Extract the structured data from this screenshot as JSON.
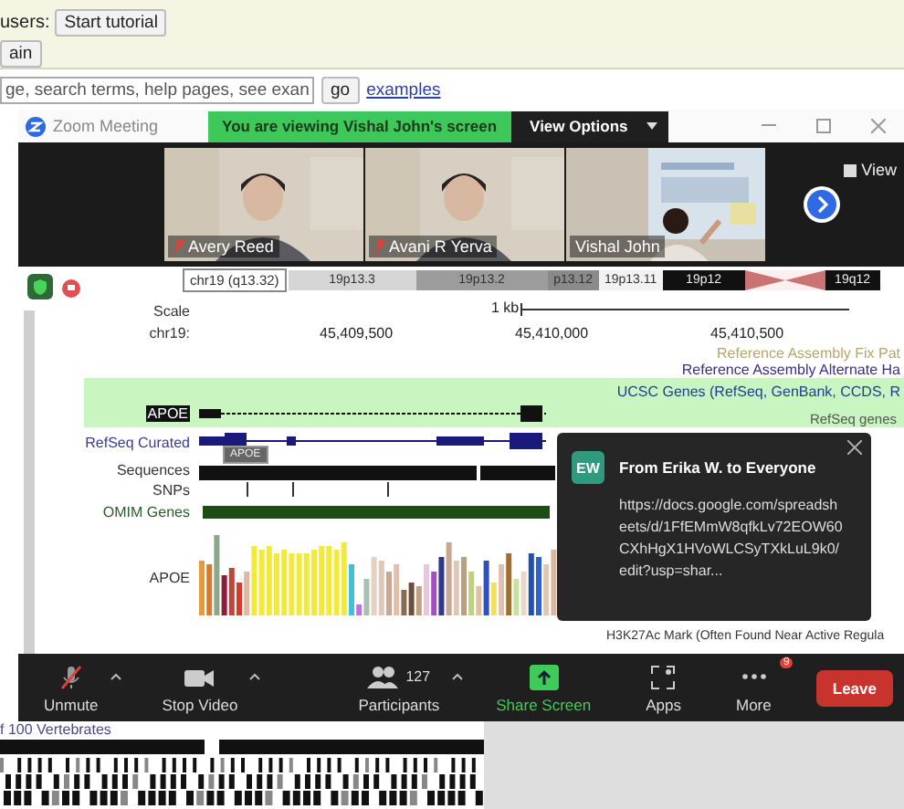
{
  "page": {
    "tutorial_label": "users:",
    "tutorial_button": "Start tutorial",
    "second_button": "ain",
    "search": {
      "value": "ge, search terms, help pages, see exan"
    },
    "go_button": "go",
    "examples_link": "examples"
  },
  "window": {
    "title": "Zoom Meeting",
    "banner": "You are viewing Vishal John's screen",
    "view_options": "View Options"
  },
  "videos": [
    {
      "name": "Avery Reed",
      "muted": true,
      "kind": "seated"
    },
    {
      "name": "Avani R Yerva",
      "muted": true,
      "kind": "seated"
    },
    {
      "name": "Vishal John",
      "muted": false,
      "kind": "presenter"
    }
  ],
  "view_button": "View",
  "browser": {
    "position": "chr19 (q13.32)",
    "bands": [
      {
        "kind": "band",
        "label": "19p13.3",
        "color": "#d6d6d6"
      },
      {
        "kind": "band",
        "label": "19p13.2",
        "color": "#9c9c9c"
      },
      {
        "kind": "band",
        "label": "p13.12",
        "color": "#8a8a8a"
      },
      {
        "kind": "band",
        "label": "19p13.11",
        "color": "#f2f2f2"
      },
      {
        "kind": "band",
        "label": "19p12",
        "color": "#111111"
      },
      {
        "kind": "centromere"
      },
      {
        "kind": "band",
        "label": "19q12",
        "color": "#111111"
      }
    ],
    "scale": {
      "label": "Scale",
      "value": "1 kb"
    },
    "coords": {
      "label": "chr19:",
      "ticks": [
        "45,409,500",
        "45,410,000",
        "45,410,500"
      ]
    },
    "notes": [
      {
        "text": "Reference Assembly Fix Pat",
        "color": "#b9a56a"
      },
      {
        "text": "Reference Assembly Alternate Ha",
        "color": "#3b2d8c"
      },
      {
        "text": "UCSC Genes (RefSeq, GenBank, CCDS, R",
        "color": "#1f3f9a"
      }
    ],
    "tracks": [
      {
        "label": "APOE",
        "kind": "gene",
        "highlight": true
      },
      {
        "label": "RefSeq Curated",
        "kind": "refseq",
        "highlight": false,
        "side_label": "RefSeq genes"
      },
      {
        "label": "Sequences",
        "kind": "sequence",
        "highlight": false
      },
      {
        "label": "SNPs",
        "kind": "snp",
        "highlight": false
      },
      {
        "label": "OMIM Genes",
        "kind": "omim",
        "highlight": false
      },
      {
        "label": "APOE",
        "kind": "bars",
        "highlight": false
      }
    ],
    "tooltip": "APOE",
    "bottom_track": "H3K27Ac Mark (Often Found Near Active Regula"
  },
  "chat": {
    "initials": "EW",
    "title": "From Erika W. to Everyone",
    "message": "https://docs.google.com/spreadsheets/d/1FfEMmW8qfkLv72EOW60CXhHgX1HVoWLCSyTXkLuL9k0/edit?usp=shar..."
  },
  "toolbar": [
    {
      "label": "Unmute",
      "kind": "mic",
      "caret": true
    },
    {
      "label": "Stop Video",
      "kind": "video",
      "caret": true
    },
    {
      "label": "Participants",
      "kind": "participants",
      "count": "127",
      "caret": true
    },
    {
      "label": "Share Screen",
      "kind": "share",
      "caret": false
    },
    {
      "label": "Apps",
      "kind": "apps",
      "caret": false
    },
    {
      "label": "More",
      "kind": "more",
      "caret": false,
      "badge": "9"
    }
  ],
  "leave_button": "Leave",
  "background_track": "f 100 Vertebrates"
}
